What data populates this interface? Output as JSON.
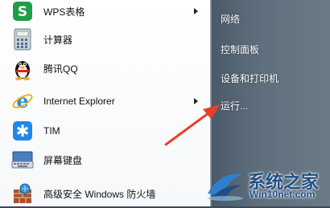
{
  "programs": [
    {
      "label": "WPS表格",
      "icon": "wps-spreadsheet-icon",
      "has_submenu": true
    },
    {
      "label": "计算器",
      "icon": "calculator-icon",
      "has_submenu": false
    },
    {
      "label": "腾讯QQ",
      "icon": "qq-penguin-icon",
      "has_submenu": false
    },
    {
      "label": "Internet Explorer",
      "icon": "internet-explorer-icon",
      "has_submenu": true
    },
    {
      "label": "TIM",
      "icon": "tim-icon",
      "has_submenu": false
    },
    {
      "label": "屏幕键盘",
      "icon": "onscreen-keyboard-icon",
      "has_submenu": false
    },
    {
      "label": "高级安全 Windows 防火墙",
      "icon": "firewall-icon",
      "has_submenu": false
    }
  ],
  "right_menu": [
    {
      "label": "网络"
    },
    {
      "label": "控制面板"
    },
    {
      "label": "设备和打印机"
    },
    {
      "label": "运行..."
    }
  ],
  "watermark": {
    "title": "系统之家",
    "url": "Win10net.com"
  },
  "colors": {
    "annotation_arrow": "#e8402a",
    "right_pane": "#5e6e7c",
    "watermark": "#1d4f86"
  }
}
